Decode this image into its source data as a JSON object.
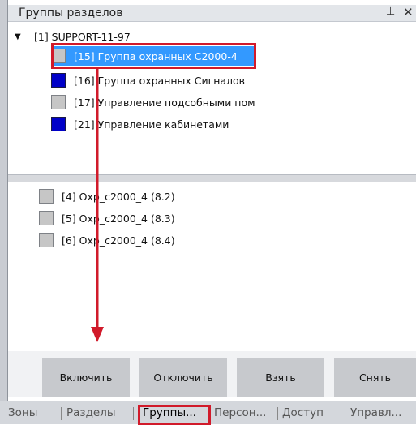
{
  "header": {
    "title": "Группы разделов",
    "pin_glyph": "⊥",
    "close_glyph": "✕"
  },
  "tree": {
    "root": {
      "label": "[1] SUPPORT-11-97",
      "expanded": true
    },
    "items": [
      {
        "label": "[15] Группа охранных С2000-4",
        "color": "gray",
        "selected": true
      },
      {
        "label": "[16] Группа охранных Сигналов",
        "color": "blue",
        "selected": false
      },
      {
        "label": "[17] Управление подсобными пом",
        "color": "gray",
        "selected": false
      },
      {
        "label": "[21] Управление кабинетами",
        "color": "blue",
        "selected": false
      }
    ]
  },
  "sections": [
    {
      "label": "[4] Охр_с2000_4 (8.2)"
    },
    {
      "label": "[5] Охр_с2000_4 (8.3)"
    },
    {
      "label": "[6] Охр_с2000_4 (8.4)"
    }
  ],
  "buttons": {
    "enable": "Включить",
    "disable": "Отключить",
    "arm": "Взять",
    "disarm": "Снять"
  },
  "tabs": [
    {
      "label": "Зоны"
    },
    {
      "label": "Разделы"
    },
    {
      "label": "Группы...",
      "active": true
    },
    {
      "label": "Персон..."
    },
    {
      "label": "Доступ"
    },
    {
      "label": "Управл..."
    }
  ],
  "colors": {
    "selection": "#3399ff",
    "checkbox_blue": "#0000c8",
    "checkbox_gray": "#c6c6c6",
    "highlight": "#d11a2a"
  }
}
